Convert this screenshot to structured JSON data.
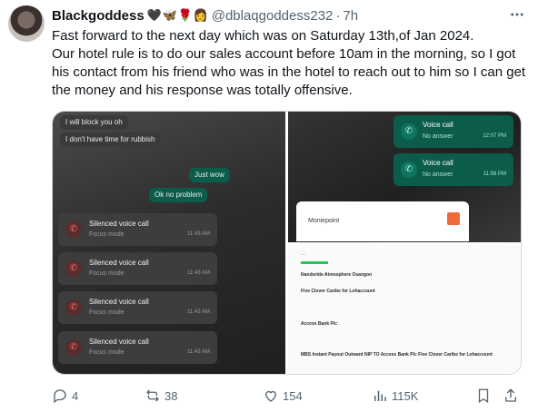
{
  "tweet": {
    "display_name": "Blackgoddess",
    "emoji_icons": [
      "black-heart",
      "butterfly",
      "rose",
      "woman-emoji"
    ],
    "handle": "@dblaqgoddess232",
    "dot": "·",
    "time": "7h",
    "text_line1": "Fast forward to the next day which was on Saturday 13th,of Jan 2024.",
    "text_line2": "Our hotel rule is to do our sales account before 10am in the morning, so I got his contact from his friend who was in the hotel to reach out to him so I can get the money and his response was totally offensive."
  },
  "chat_screenshot": {
    "messages_in": [
      "I will block you oh",
      "I don't have time for rubbish"
    ],
    "messages_out": [
      "Just wow",
      "Ok no problem"
    ],
    "call_title": "Silenced voice call",
    "call_sub": "Focus mode",
    "call_time": "11:43 AM"
  },
  "voice_screenshot": {
    "title": "Voice call",
    "sub": "No answer",
    "times": [
      "12:07 PM",
      "11:56 PM"
    ],
    "popup_name": "Moniepoint"
  },
  "receipt": {
    "lines": [
      "Nandoride Atmosphere Osangon",
      "Five Clover Caribe for Lohaccount",
      "Access Bank Plc",
      "MBS Instant Payout Outward NIP TO Access Bank Plc Five Clover Caribe for Lohaccount"
    ]
  },
  "actions": {
    "replies": "4",
    "reposts": "38",
    "likes": "154",
    "views": "115K"
  },
  "colors": {
    "text": "#0f1419",
    "secondary": "#536471",
    "whatsapp_green": "#0b5c4b"
  }
}
